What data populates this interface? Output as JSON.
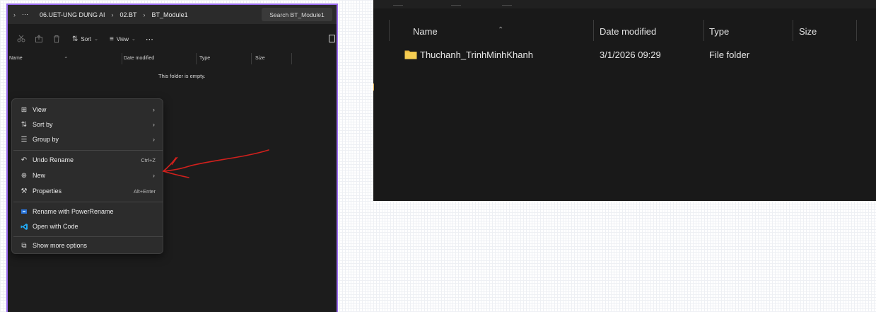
{
  "left": {
    "breadcrumb": {
      "more": "⋯",
      "seg1": "06.UET-UNG DUNG AI",
      "seg2": "02.BT",
      "seg3": "BT_Module1"
    },
    "search_placeholder": "Search BT_Module1",
    "toolbar": {
      "sort_label": "Sort",
      "view_label": "View",
      "more_label": "⋯"
    },
    "columns": {
      "name": "Name",
      "date": "Date modified",
      "type": "Type",
      "size": "Size"
    },
    "empty_message": "This folder is empty.",
    "context_menu": {
      "view": "View",
      "sort_by": "Sort by",
      "group_by": "Group by",
      "undo_rename": "Undo Rename",
      "undo_shortcut": "Ctrl+Z",
      "new": "New",
      "properties": "Properties",
      "properties_shortcut": "Alt+Enter",
      "rename_power": "Rename with PowerRename",
      "open_code": "Open with Code",
      "more_options": "Show more options"
    }
  },
  "right": {
    "columns": {
      "name": "Name",
      "date": "Date modified",
      "type": "Type",
      "size": "Size"
    },
    "rows": [
      {
        "name": "Thuchanh_TrinhMinhKhanh",
        "date": "3/1/2026 09:29",
        "type": "File folder",
        "size": ""
      }
    ]
  },
  "colors": {
    "accent_border": "#9b6cf0",
    "annotation_arrow": "#d0201c",
    "folder": "#f2c94c",
    "vscode": "#23a9f2"
  }
}
